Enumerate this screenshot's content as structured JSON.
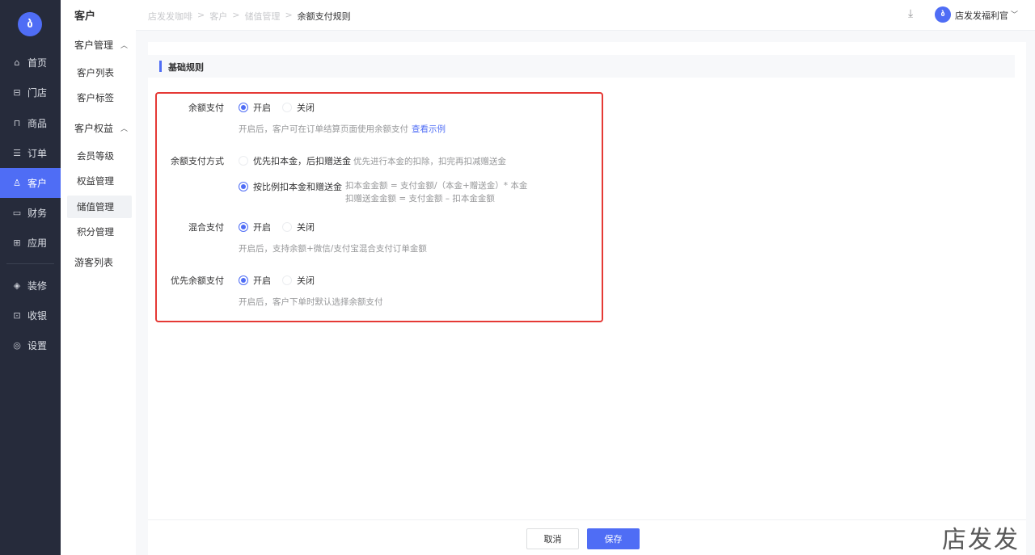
{
  "brand": {
    "logo_text": "ბ"
  },
  "rail": {
    "items": [
      {
        "icon": "home-icon",
        "glyph": "⌂",
        "label": "首页"
      },
      {
        "icon": "store-icon",
        "glyph": "⊟",
        "label": "门店"
      },
      {
        "icon": "goods-icon",
        "glyph": "⊓",
        "label": "商品"
      },
      {
        "icon": "order-icon",
        "glyph": "☰",
        "label": "订单"
      },
      {
        "icon": "customer-icon",
        "glyph": "♙",
        "label": "客户"
      },
      {
        "icon": "finance-icon",
        "glyph": "▭",
        "label": "财务"
      },
      {
        "icon": "apps-icon",
        "glyph": "⊞",
        "label": "应用"
      },
      {
        "icon": "decorate-icon",
        "glyph": "◈",
        "label": "装修"
      },
      {
        "icon": "cashier-icon",
        "glyph": "⊡",
        "label": "收银"
      },
      {
        "icon": "settings-icon",
        "glyph": "◎",
        "label": "设置"
      }
    ]
  },
  "subnav": {
    "title": "客户",
    "group1": "客户管理",
    "customer_list": "客户列表",
    "customer_tags": "客户标签",
    "group2": "客户权益",
    "member_level": "会员等级",
    "rights_mgmt": "权益管理",
    "stored_value": "储值管理",
    "points_mgmt": "积分管理",
    "visitor_list": "游客列表"
  },
  "header": {
    "crumbs": [
      "店发发咖啡",
      "客户",
      "储值管理",
      "余额支付规则"
    ],
    "sep": ">",
    "user_name": "店发发福利官",
    "avatar_text": "ბ"
  },
  "section": {
    "title": "基础规则"
  },
  "form": {
    "balance_pay": {
      "label": "余额支付",
      "on": "开启",
      "off": "关闭",
      "help": "开启后，客户可在订单结算页面使用余额支付",
      "link": "查看示例"
    },
    "pay_method": {
      "label": "余额支付方式",
      "opt1": "优先扣本金，后扣赠送金",
      "opt1_help": "优先进行本金的扣除，扣完再扣减赠送金",
      "opt2": "按比例扣本金和赠送金",
      "opt2_help1": "扣本金金额 = 支付金额/（本金+赠送金）* 本金",
      "opt2_help2": "扣赠送金金额 = 支付金额 – 扣本金金额"
    },
    "mixed_pay": {
      "label": "混合支付",
      "on": "开启",
      "off": "关闭",
      "help": "开启后，支持余额+微信/支付宝混合支付订单金额"
    },
    "priority_pay": {
      "label": "优先余额支付",
      "on": "开启",
      "off": "关闭",
      "help": "开启后，客户下单时默认选择余额支付"
    }
  },
  "footer": {
    "cancel": "取消",
    "save": "保存"
  },
  "watermark": "店发发",
  "colors": {
    "accent": "#4f6df5",
    "rail_bg": "#262b3b",
    "highlight_border": "#e53935"
  }
}
